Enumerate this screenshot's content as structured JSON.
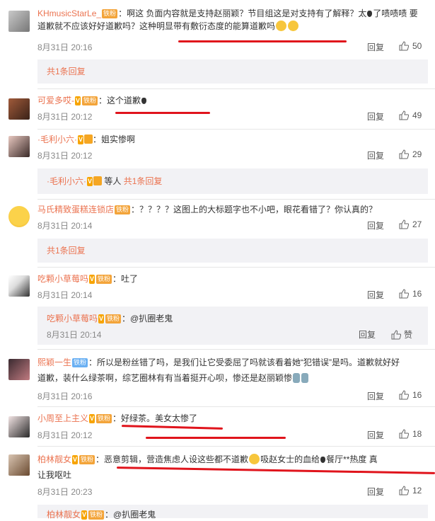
{
  "comments": [
    {
      "user": "KHmusicStarLe_",
      "badge": "铁粉",
      "text_a": "：啊这 负面内容就是支持赵丽颖？节目组这是对支持有了解释？太",
      "text_b": "了啧啧啧 要道歉就不应该好好道歉吗？这种明显带有敷衍态度的能算道歉吗",
      "time": "8月31日 20:16",
      "reply": "回复",
      "likes": "50",
      "sub_more": "共1条回复"
    },
    {
      "user": "可爱多哎-",
      "badge": "铁粉",
      "text": "：这个道歉",
      "time": "8月31日 20:12",
      "reply": "回复",
      "likes": "49"
    },
    {
      "user": "·毛利小六·",
      "text": "：姐实惨啊",
      "time": "8月31日 20:12",
      "reply": "回复",
      "likes": "29",
      "sub_user": "·毛利小六·",
      "sub_text": "等人",
      "sub_more": "共1条回复"
    },
    {
      "user": "马氏精致蛋糕连锁店",
      "badge": "铁粉",
      "text": "：？？？？这图上的大标题字也不小吧，眼花看错了？你认真的？",
      "time": "8月31日 20:14",
      "reply": "回复",
      "likes": "27",
      "sub_more": "共1条回复"
    },
    {
      "user": "吃颗小草莓吗",
      "badge": "铁粉",
      "text": "：吐了",
      "time": "8月31日 20:14",
      "reply": "回复",
      "likes": "16",
      "sub_user": "吃颗小草莓吗",
      "sub_badge": "铁粉",
      "sub_text": "：@扒圈老鬼",
      "sub_time": "8月31日 20:14",
      "sub_reply": "回复",
      "sub_like": "赞"
    },
    {
      "user": "熙颖一生",
      "badge": "铁粉",
      "text_a": "：所以是粉丝错了吗，是我们让它受委屈了吗就该看着她“犯错误”是吗。道歉就好好",
      "text_b": "道歉，装什么绿茶啊，综艺圈林有有当着挺开心呗，惨还是赵丽颖惨",
      "time": "8月31日 20:16",
      "reply": "回复",
      "likes": "16"
    },
    {
      "user": "小周至上主义",
      "badge": "铁粉",
      "text": "：好绿茶。美女太惨了",
      "time": "8月31日 20:12",
      "reply": "回复",
      "likes": "18"
    },
    {
      "user": "柏林靓女",
      "badge": "铁粉",
      "text_a": "：恶意剪辑，营造焦虑人设这些都不道歉",
      "text_a2": "吸赵女士的血给",
      "text_a3": "餐厅**热度 真",
      "text_b": "让我呕吐",
      "time": "8月31日 20:23",
      "reply": "回复",
      "likes": "12",
      "sub_user": "柏林靓女",
      "sub_badge": "铁粉",
      "sub_text": "：@扒圈老鬼"
    }
  ],
  "colors": {
    "username": "#eb7350",
    "underline": "#e0141c",
    "subbox": "#f2f2f5"
  }
}
